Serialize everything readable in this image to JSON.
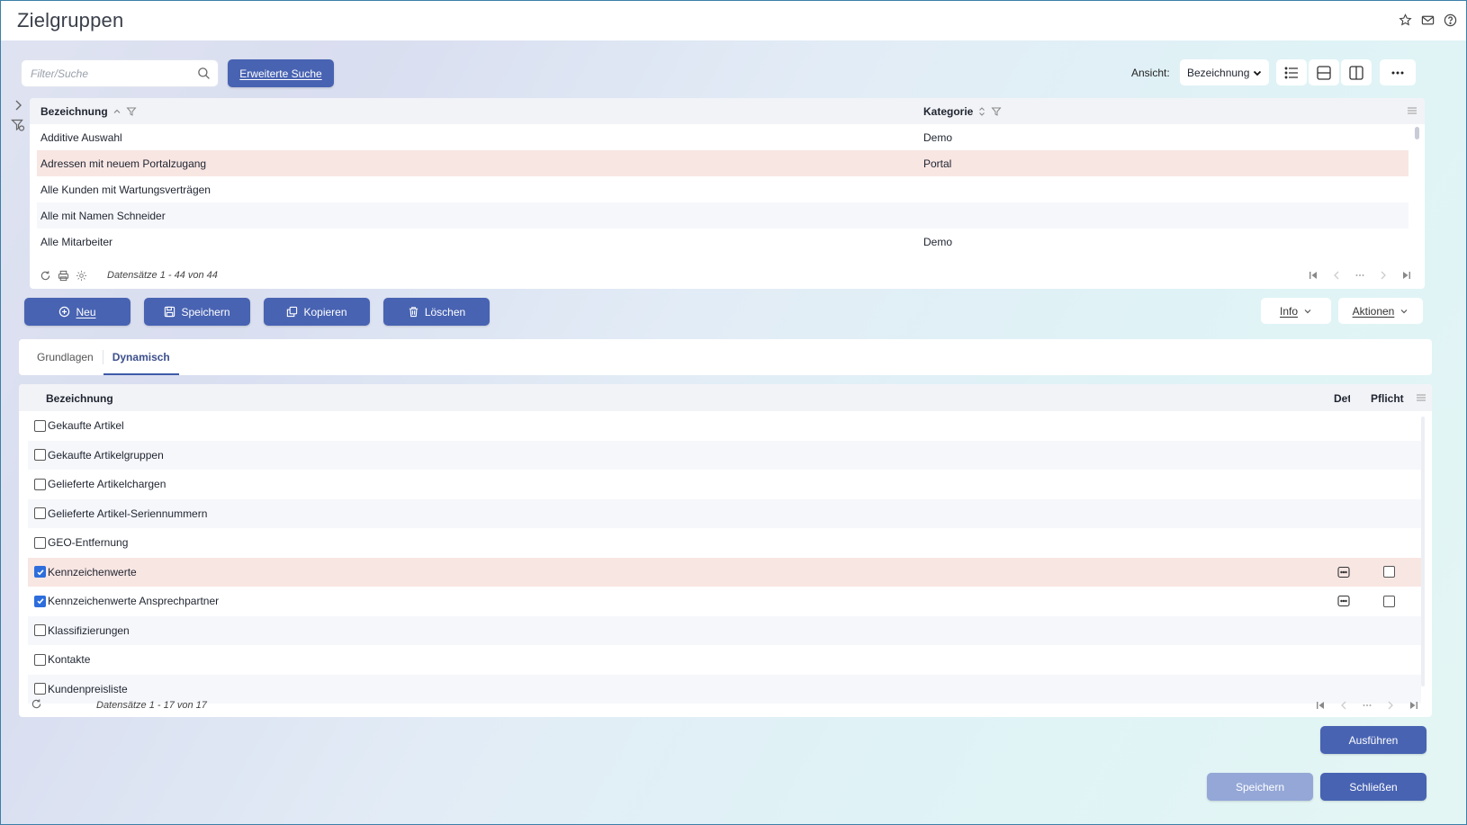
{
  "window": {
    "title": "Zielgruppen"
  },
  "icons": {
    "favorite": "star-icon",
    "mail": "mail-icon",
    "help": "help-icon"
  },
  "search": {
    "placeholder": "Filter/Suche",
    "value": "",
    "advanced_label": "Erweiterte Suche"
  },
  "view": {
    "label": "Ansicht:",
    "selected": "Bezeichnung"
  },
  "grid1": {
    "columns": [
      "Bezeichnung",
      "Kategorie"
    ],
    "rows": [
      {
        "name": "Additive Auswahl",
        "category": "Demo"
      },
      {
        "name": "Adressen mit neuem Portalzugang",
        "category": "Portal"
      },
      {
        "name": "Alle Kunden mit Wartungsverträgen",
        "category": ""
      },
      {
        "name": "Alle mit Namen Schneider",
        "category": ""
      },
      {
        "name": "Alle Mitarbeiter",
        "category": "Demo"
      }
    ],
    "selected_row": 1,
    "record_count": "Datensätze 1 - 44 von 44"
  },
  "actions": {
    "new": "Neu",
    "save": "Speichern",
    "copy": "Kopieren",
    "delete": "Löschen",
    "info": "Info",
    "more_actions": "Aktionen"
  },
  "tabs": [
    {
      "label": "Grundlagen",
      "active": false
    },
    {
      "label": "Dynamisch",
      "active": true
    }
  ],
  "grid2": {
    "columns": [
      "Bezeichnung",
      "Details",
      "Pflicht"
    ],
    "rows": [
      {
        "label": "Gekaufte Artikel",
        "checked": false
      },
      {
        "label": "Gekaufte Artikelgruppen",
        "checked": false
      },
      {
        "label": "Gelieferte Artikelchargen",
        "checked": false
      },
      {
        "label": "Gelieferte Artikel-Seriennummern",
        "checked": false
      },
      {
        "label": "GEO-Entfernung",
        "checked": false
      },
      {
        "label": "Kennzeichenwerte",
        "checked": true
      },
      {
        "label": "Kennzeichenwerte Ansprechpartner",
        "checked": true
      },
      {
        "label": "Klassifizierungen",
        "checked": false
      },
      {
        "label": "Kontakte",
        "checked": false
      },
      {
        "label": "Kundenpreisliste",
        "checked": false
      }
    ],
    "selected_row": 5,
    "record_count": "Datensätze 1 - 17 von 17"
  },
  "footer": {
    "run": "Ausführen",
    "save": "Speichern",
    "close": "Schließen"
  }
}
